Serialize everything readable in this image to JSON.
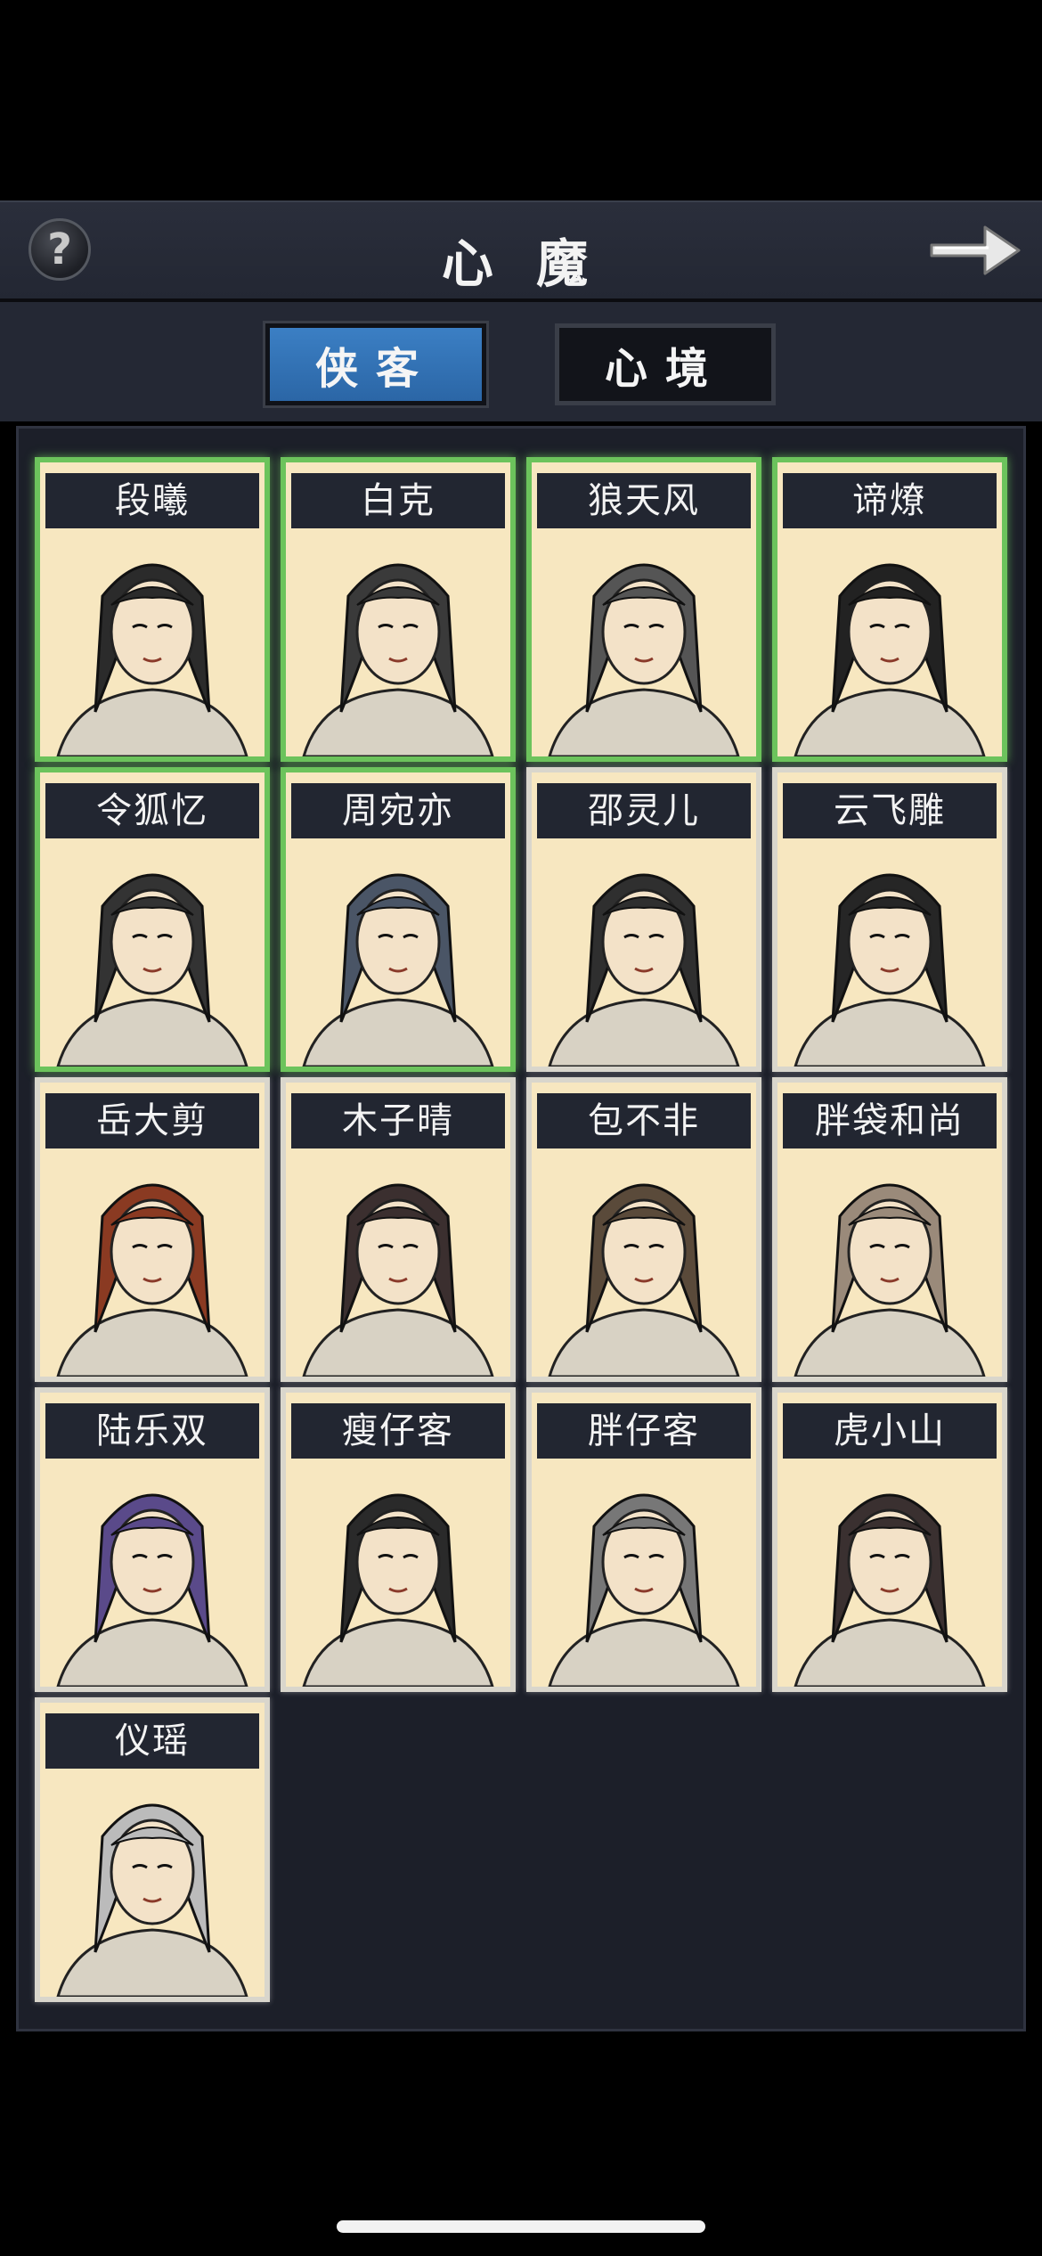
{
  "header": {
    "title": "心 魔",
    "help_label": "?"
  },
  "tabs": [
    {
      "label": "侠客",
      "active": true
    },
    {
      "label": "心境",
      "active": false
    }
  ],
  "characters": [
    {
      "name": "段曦",
      "owned": true
    },
    {
      "name": "白克",
      "owned": true
    },
    {
      "name": "狼天风",
      "owned": true
    },
    {
      "name": "谛燎",
      "owned": true
    },
    {
      "name": "令狐忆",
      "owned": true
    },
    {
      "name": "周宛亦",
      "owned": true
    },
    {
      "name": "邵灵儿",
      "owned": false
    },
    {
      "name": "云飞雕",
      "owned": false
    },
    {
      "name": "岳大剪",
      "owned": false
    },
    {
      "name": "木子晴",
      "owned": false
    },
    {
      "name": "包不非",
      "owned": false
    },
    {
      "name": "胖袋和尚",
      "owned": false
    },
    {
      "name": "陆乐双",
      "owned": false
    },
    {
      "name": "瘦仔客",
      "owned": false
    },
    {
      "name": "胖仔客",
      "owned": false
    },
    {
      "name": "虎小山",
      "owned": false
    },
    {
      "name": "仪瑶",
      "owned": false
    }
  ],
  "colors": {
    "owned_border": "#6cc35c",
    "active_tab": "#3b7fc4",
    "card_background": "#f7e7c0"
  }
}
